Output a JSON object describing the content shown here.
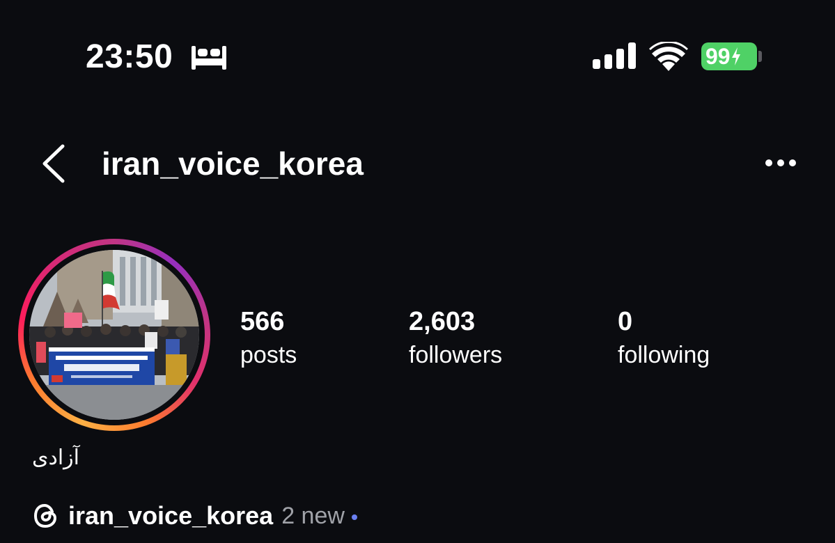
{
  "status_bar": {
    "time": "23:50",
    "battery_level": "99",
    "battery_color": "#4fd166",
    "icons": [
      "bed-icon",
      "cellular-signal-icon",
      "wifi-icon",
      "battery-icon"
    ]
  },
  "header": {
    "username": "iran_voice_korea",
    "back_icon": "chevron-left-icon",
    "more_icon": "ellipsis-icon"
  },
  "profile": {
    "avatar_ring_colors": [
      "#fcb045",
      "#fd1d5c",
      "#c13584",
      "#962fbf"
    ],
    "stats": {
      "posts_count": "566",
      "posts_label": "posts",
      "followers_count": "2,603",
      "followers_label": "followers",
      "following_count": "0",
      "following_label": "following"
    },
    "display_name": "آزادی",
    "threads": {
      "icon": "threads-icon",
      "handle": "iran_voice_korea",
      "new_label": "2 new",
      "dot_color": "#6a7ff0"
    }
  }
}
